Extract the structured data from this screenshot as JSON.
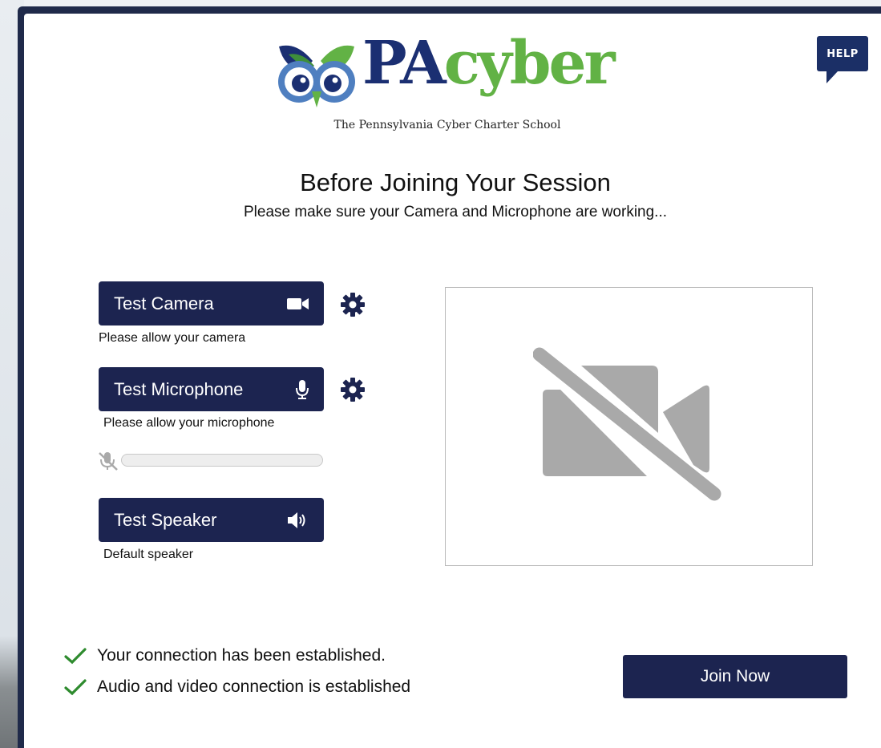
{
  "help": {
    "label": "HELP",
    "icon": "help-speech-bubble-icon"
  },
  "logo": {
    "brand_pa": "PA",
    "brand_cyber": "cyber",
    "tagline": "The Pennsylvania Cyber Charter School",
    "colors": {
      "navy": "#1b2f72",
      "green": "#62b245"
    }
  },
  "heading": {
    "title": "Before Joining Your Session",
    "subtitle": "Please make sure your Camera and Microphone are working..."
  },
  "devices": {
    "camera": {
      "button_label": "Test Camera",
      "icon": "video-camera-icon",
      "hint": "Please allow your camera"
    },
    "microphone": {
      "button_label": "Test Microphone",
      "icon": "microphone-icon",
      "hint": "Please allow your microphone",
      "level": 0
    },
    "speaker": {
      "button_label": "Test Speaker",
      "icon": "speaker-volume-icon",
      "hint": "Default speaker"
    }
  },
  "preview": {
    "icon": "video-off-icon"
  },
  "status": [
    {
      "text": "Your connection has been established.",
      "icon": "check-icon"
    },
    {
      "text": "Audio and video connection is established",
      "icon": "check-icon"
    }
  ],
  "join": {
    "label": "Join Now"
  },
  "colors": {
    "button": "#1c2450",
    "help": "#1b2f66",
    "check": "#2e8b2e",
    "preview_icon": "#a9a9a9"
  }
}
